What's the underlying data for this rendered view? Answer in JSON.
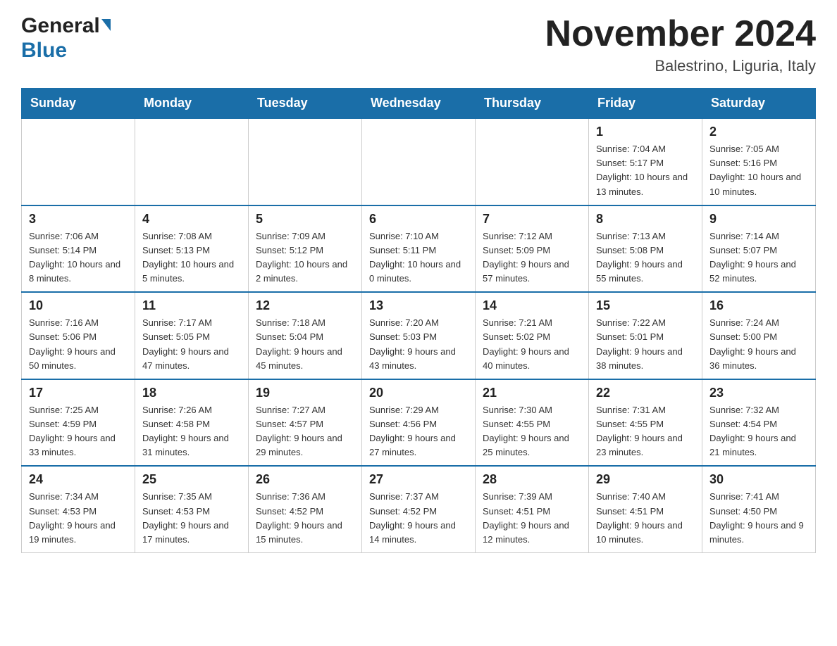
{
  "header": {
    "logo_general": "General",
    "logo_blue": "Blue",
    "month_title": "November 2024",
    "location": "Balestrino, Liguria, Italy"
  },
  "days_of_week": [
    "Sunday",
    "Monday",
    "Tuesday",
    "Wednesday",
    "Thursday",
    "Friday",
    "Saturday"
  ],
  "weeks": [
    [
      {
        "day": "",
        "info": ""
      },
      {
        "day": "",
        "info": ""
      },
      {
        "day": "",
        "info": ""
      },
      {
        "day": "",
        "info": ""
      },
      {
        "day": "",
        "info": ""
      },
      {
        "day": "1",
        "info": "Sunrise: 7:04 AM\nSunset: 5:17 PM\nDaylight: 10 hours and 13 minutes."
      },
      {
        "day": "2",
        "info": "Sunrise: 7:05 AM\nSunset: 5:16 PM\nDaylight: 10 hours and 10 minutes."
      }
    ],
    [
      {
        "day": "3",
        "info": "Sunrise: 7:06 AM\nSunset: 5:14 PM\nDaylight: 10 hours and 8 minutes."
      },
      {
        "day": "4",
        "info": "Sunrise: 7:08 AM\nSunset: 5:13 PM\nDaylight: 10 hours and 5 minutes."
      },
      {
        "day": "5",
        "info": "Sunrise: 7:09 AM\nSunset: 5:12 PM\nDaylight: 10 hours and 2 minutes."
      },
      {
        "day": "6",
        "info": "Sunrise: 7:10 AM\nSunset: 5:11 PM\nDaylight: 10 hours and 0 minutes."
      },
      {
        "day": "7",
        "info": "Sunrise: 7:12 AM\nSunset: 5:09 PM\nDaylight: 9 hours and 57 minutes."
      },
      {
        "day": "8",
        "info": "Sunrise: 7:13 AM\nSunset: 5:08 PM\nDaylight: 9 hours and 55 minutes."
      },
      {
        "day": "9",
        "info": "Sunrise: 7:14 AM\nSunset: 5:07 PM\nDaylight: 9 hours and 52 minutes."
      }
    ],
    [
      {
        "day": "10",
        "info": "Sunrise: 7:16 AM\nSunset: 5:06 PM\nDaylight: 9 hours and 50 minutes."
      },
      {
        "day": "11",
        "info": "Sunrise: 7:17 AM\nSunset: 5:05 PM\nDaylight: 9 hours and 47 minutes."
      },
      {
        "day": "12",
        "info": "Sunrise: 7:18 AM\nSunset: 5:04 PM\nDaylight: 9 hours and 45 minutes."
      },
      {
        "day": "13",
        "info": "Sunrise: 7:20 AM\nSunset: 5:03 PM\nDaylight: 9 hours and 43 minutes."
      },
      {
        "day": "14",
        "info": "Sunrise: 7:21 AM\nSunset: 5:02 PM\nDaylight: 9 hours and 40 minutes."
      },
      {
        "day": "15",
        "info": "Sunrise: 7:22 AM\nSunset: 5:01 PM\nDaylight: 9 hours and 38 minutes."
      },
      {
        "day": "16",
        "info": "Sunrise: 7:24 AM\nSunset: 5:00 PM\nDaylight: 9 hours and 36 minutes."
      }
    ],
    [
      {
        "day": "17",
        "info": "Sunrise: 7:25 AM\nSunset: 4:59 PM\nDaylight: 9 hours and 33 minutes."
      },
      {
        "day": "18",
        "info": "Sunrise: 7:26 AM\nSunset: 4:58 PM\nDaylight: 9 hours and 31 minutes."
      },
      {
        "day": "19",
        "info": "Sunrise: 7:27 AM\nSunset: 4:57 PM\nDaylight: 9 hours and 29 minutes."
      },
      {
        "day": "20",
        "info": "Sunrise: 7:29 AM\nSunset: 4:56 PM\nDaylight: 9 hours and 27 minutes."
      },
      {
        "day": "21",
        "info": "Sunrise: 7:30 AM\nSunset: 4:55 PM\nDaylight: 9 hours and 25 minutes."
      },
      {
        "day": "22",
        "info": "Sunrise: 7:31 AM\nSunset: 4:55 PM\nDaylight: 9 hours and 23 minutes."
      },
      {
        "day": "23",
        "info": "Sunrise: 7:32 AM\nSunset: 4:54 PM\nDaylight: 9 hours and 21 minutes."
      }
    ],
    [
      {
        "day": "24",
        "info": "Sunrise: 7:34 AM\nSunset: 4:53 PM\nDaylight: 9 hours and 19 minutes."
      },
      {
        "day": "25",
        "info": "Sunrise: 7:35 AM\nSunset: 4:53 PM\nDaylight: 9 hours and 17 minutes."
      },
      {
        "day": "26",
        "info": "Sunrise: 7:36 AM\nSunset: 4:52 PM\nDaylight: 9 hours and 15 minutes."
      },
      {
        "day": "27",
        "info": "Sunrise: 7:37 AM\nSunset: 4:52 PM\nDaylight: 9 hours and 14 minutes."
      },
      {
        "day": "28",
        "info": "Sunrise: 7:39 AM\nSunset: 4:51 PM\nDaylight: 9 hours and 12 minutes."
      },
      {
        "day": "29",
        "info": "Sunrise: 7:40 AM\nSunset: 4:51 PM\nDaylight: 9 hours and 10 minutes."
      },
      {
        "day": "30",
        "info": "Sunrise: 7:41 AM\nSunset: 4:50 PM\nDaylight: 9 hours and 9 minutes."
      }
    ]
  ]
}
